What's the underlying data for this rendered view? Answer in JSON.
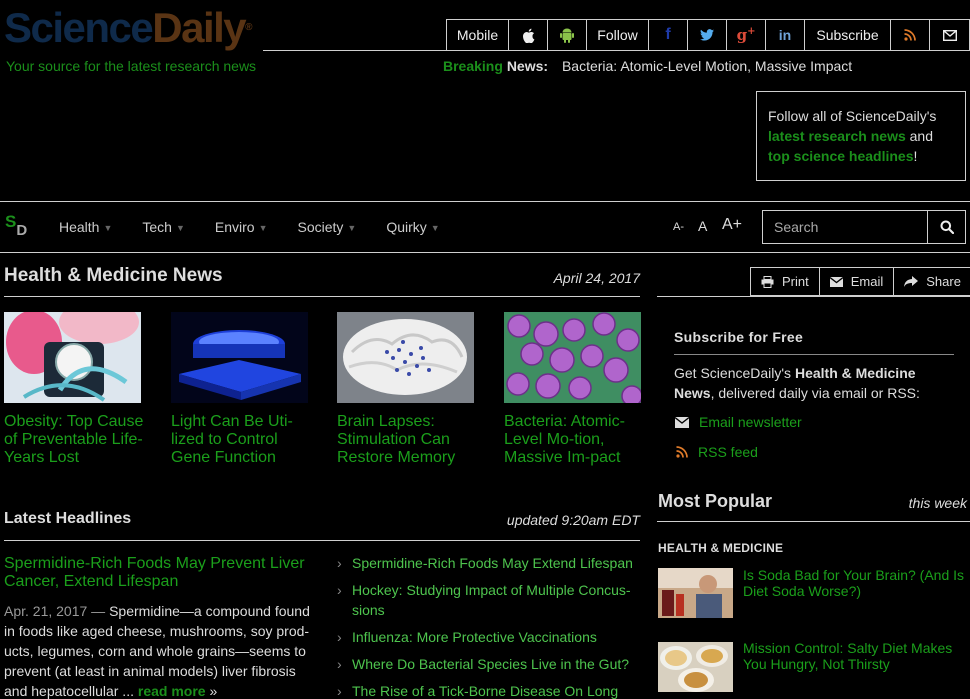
{
  "header": {
    "logo_part1": "Science",
    "logo_part2": "Daily",
    "logo_mark": "®",
    "tagline": "Your source for the latest research news",
    "topnav": {
      "mobile": "Mobile",
      "follow": "Follow",
      "subscribe": "Subscribe"
    },
    "breaking_label1": "Breaking",
    "breaking_label2": "News",
    "breaking_sep": ":",
    "breaking_headline": "Bacteria: Atomic-Level Motion, Massive Impact",
    "followbox": {
      "text1": "Follow all of ScienceDaily's",
      "link1": "latest research news",
      "text2": "and",
      "link2": "top science headlines",
      "text3": "!"
    }
  },
  "nav": {
    "logo_s": "S",
    "logo_d": "D",
    "items": [
      {
        "label": "Health"
      },
      {
        "label": "Tech"
      },
      {
        "label": "Enviro"
      },
      {
        "label": "Society"
      },
      {
        "label": "Quirky"
      }
    ],
    "font_small": "A-",
    "font_normal": "A",
    "font_large": "A+",
    "search_placeholder": "Search"
  },
  "main": {
    "section_title": "Health & Medicine News",
    "date": "April 24, 2017",
    "stories": [
      {
        "title": "Obesity: Top Cause of Preventable Life-Years Lost"
      },
      {
        "title": "Light Can Be Uti-lized to Control Gene Function"
      },
      {
        "title": "Brain Lapses: Stimulation Can Restore Memory"
      },
      {
        "title": "Bacteria: Atomic-Level Mo-tion, Massive Im-pact"
      }
    ],
    "latest_title": "Latest Headlines",
    "updated": "updated 9:20am EDT",
    "lead": {
      "title": "Spermidine-Rich Foods May Prevent Liver Cancer, Extend Lifespan",
      "date": "Apr. 21, 2017",
      "dash": " — ",
      "body": "Spermidine—a compound found in foods like aged cheese, mushrooms, soy prod-ucts, legumes, corn and whole grains—seems to prevent (at least in animal models) liver fibrosis and hepatocellular ...",
      "more": "read more",
      "more_arrow": "»"
    },
    "headlines": [
      "Spermidine-Rich Foods May Extend Lifespan",
      "Hockey: Studying Impact of Multiple Concus-sions",
      "Influenza: More Protective Vaccinations",
      "Where Do Bacterial Species Live in the Gut?",
      "The Rise of a Tick-Borne Disease On Long"
    ]
  },
  "sidebar": {
    "share": {
      "print": "Print",
      "email": "Email",
      "share": "Share"
    },
    "subscribe_title": "Subscribe for Free",
    "subscribe_text1": "Get ScienceDaily's ",
    "subscribe_bold": "Health & Medicine News",
    "subscribe_text2": ", delivered daily via email or RSS:",
    "email_newsletter": "Email newsletter",
    "rss_feed": "RSS feed",
    "most_popular": "Most Popular",
    "this_week": "this week",
    "category": "HEALTH & MEDICINE",
    "popular": [
      {
        "title": "Is Soda Bad for Your Brain? (And Is Diet Soda Worse?)"
      },
      {
        "title": "Mission Control: Salty Diet Makes You Hungry, Not Thirsty"
      }
    ]
  },
  "colors": {
    "accent_green": "#1b9f1b",
    "rss_orange": "#e07b2a",
    "facebook_blue": "#1e3aa8",
    "twitter_blue": "#55acee",
    "google_red": "#dd4b39",
    "android_green": "#8bc34a"
  },
  "icons": [
    "apple-icon",
    "android-icon",
    "facebook-icon",
    "twitter-icon",
    "google-plus-icon",
    "linkedin-icon",
    "rss-icon",
    "mail-icon",
    "search-icon",
    "print-icon",
    "share-icon"
  ]
}
